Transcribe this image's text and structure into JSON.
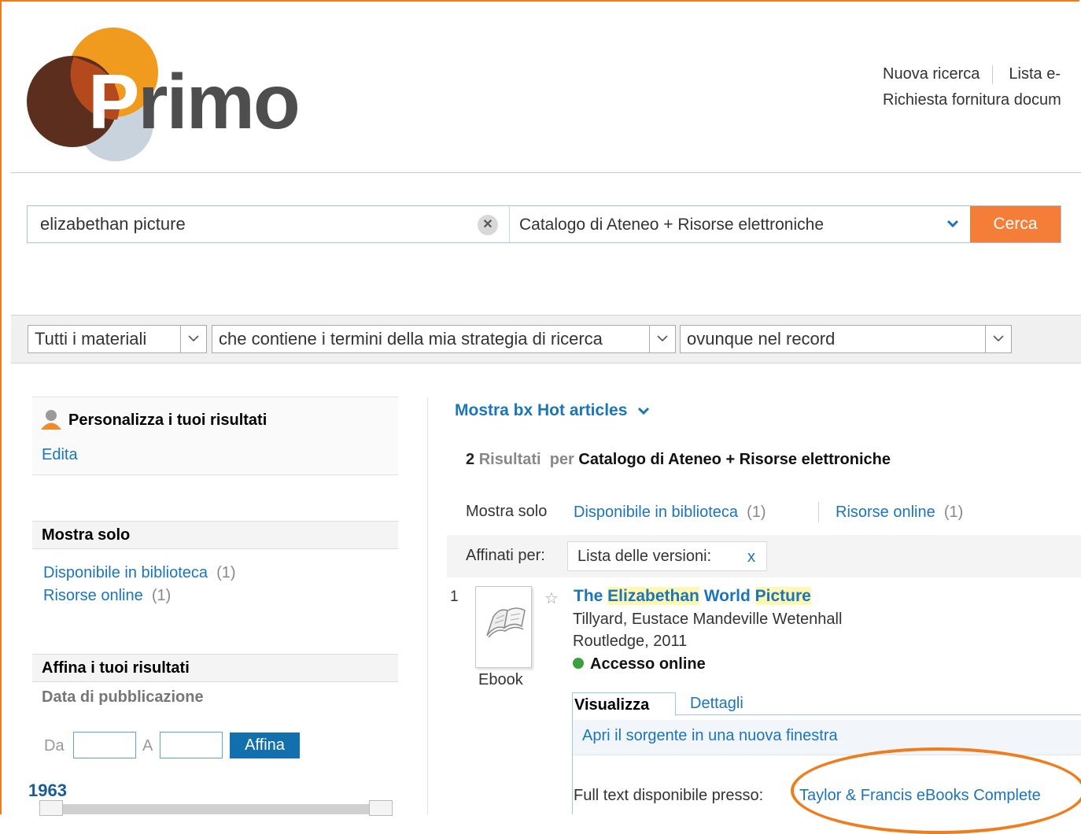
{
  "header": {
    "logo_text": "Primo",
    "nav_row1": [
      "Nuova ricerca",
      "Lista e-"
    ],
    "nav_row2": "Richiesta fornitura docum"
  },
  "search": {
    "query": "elizabethan picture",
    "clear_icon": "close-icon",
    "scope": "Catalogo di Ateneo + Risorse elettroniche",
    "button": "Cerca"
  },
  "filters": {
    "material": "Tutti i materiali",
    "match": "che contiene i termini della mia strategia di ricerca",
    "field": "ovunque nel record"
  },
  "sidebar": {
    "personalize_title": "Personalizza i tuoi risultati",
    "edit_link": "Edita",
    "show_only_title": "Mostra solo",
    "show_only_items": [
      {
        "label": "Disponibile in biblioteca",
        "count": "(1)"
      },
      {
        "label": "Risorse online",
        "count": "(1)"
      }
    ],
    "refine_title": "Affina i tuoi risultati",
    "pub_date_title": "Data di pubblicazione",
    "from_label": "Da",
    "to_label": "A",
    "refine_button": "Affina",
    "year_start": "1963"
  },
  "results": {
    "hot_articles": "Mostra bx Hot articles",
    "count": "2",
    "count_label": "Risultati",
    "per_label": "per",
    "scope": "Catalogo di Ateneo + Risorse elettroniche",
    "show_only_label": "Mostra solo",
    "show_only_items": [
      {
        "label": "Disponibile in biblioteca",
        "count": "(1)"
      },
      {
        "label": "Risorse online",
        "count": "(1)"
      }
    ],
    "refined_by_label": "Affinati per:",
    "refined_by_value": "Lista delle versioni:",
    "remove_icon": "x",
    "items": [
      {
        "index": "1",
        "title_parts": [
          "The ",
          "Elizabethan",
          " World ",
          "Picture"
        ],
        "author": "Tillyard, Eustace Mandeville Wetenhall",
        "publisher": "Routledge, 2011",
        "access": "Accesso online",
        "type": "Ebook",
        "tabs": [
          "Visualizza",
          "Dettagli"
        ],
        "open_source": "Apri il sorgente in una nuova finestra",
        "fulltext_label": "Full text disponibile presso:",
        "fulltext_link": "Taylor & Francis eBooks Complete"
      }
    ]
  },
  "colors": {
    "accent": "#f47e37",
    "link": "#1b75bb",
    "highlight_annotation": "#f07c1c"
  }
}
